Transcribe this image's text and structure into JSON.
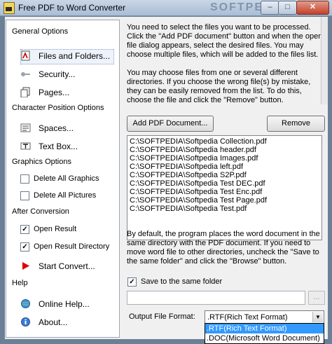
{
  "window": {
    "title": "Free PDF to Word Converter",
    "watermark": "SOFTPEDIA"
  },
  "sidebar": {
    "general_header": "General Options",
    "files_folders": "Files and Folders...",
    "security": "Security...",
    "pages": "Pages...",
    "charpos_header": "Character Position Options",
    "spaces": "Spaces...",
    "textbox": "Text Box...",
    "graphics_header": "Graphics Options",
    "delete_graphics": "Delete All Graphics",
    "delete_pictures": "Delete All Pictures",
    "after_header": "After Conversion",
    "open_result": "Open Result",
    "open_result_dir": "Open Result Directory",
    "start_convert": "Start Convert...",
    "help_header": "Help",
    "online_help": "Online Help...",
    "about": "About..."
  },
  "checks": {
    "delete_graphics": false,
    "delete_pictures": false,
    "open_result": true,
    "open_result_dir": true,
    "save_same_folder": true
  },
  "main": {
    "desc1": "You need to select the files you want to be processed. Click the \"Add PDF document\" button and when the open file dialog appears, select the desired files. You may choose multiple files, which will be added to the files list.",
    "desc2": "You may choose files from one or several different directories. If you choose the wrong file(s) by mistake, they can be easily removed from the list. To do this, choose the file and click the \"Remove\" button.",
    "add_button": "Add PDF Document...",
    "remove_button": "Remove",
    "files": [
      "C:\\SOFTPEDIA\\Softpedia Collection.pdf",
      "C:\\SOFTPEDIA\\Softpedia header.pdf",
      "C:\\SOFTPEDIA\\Softpedia Images.pdf",
      "C:\\SOFTPEDIA\\Softpedia left.pdf",
      "C:\\SOFTPEDIA\\Softpedia S2P.pdf",
      "C:\\SOFTPEDIA\\Softpedia Test DEC.pdf",
      "C:\\SOFTPEDIA\\Softpedia Test Enc.pdf",
      "C:\\SOFTPEDIA\\Softpedia Test Page.pdf",
      "C:\\SOFTPEDIA\\Softpedia Test.pdf"
    ],
    "desc3": "By default, the program places the word document in the same directory with the PDF document. If you need to move word file to other directories, uncheck the \"Save to the same folder\" and click the \"Browse\" button.",
    "save_same_folder": "Save to the same folder",
    "output_path": "",
    "browse_label": "...",
    "format_label": "Output File Format:",
    "format_selected": ".RTF(Rich Text Format)",
    "format_options": [
      ".RTF(Rich Text Format)",
      ".DOC(Microsoft Word Document)"
    ]
  }
}
